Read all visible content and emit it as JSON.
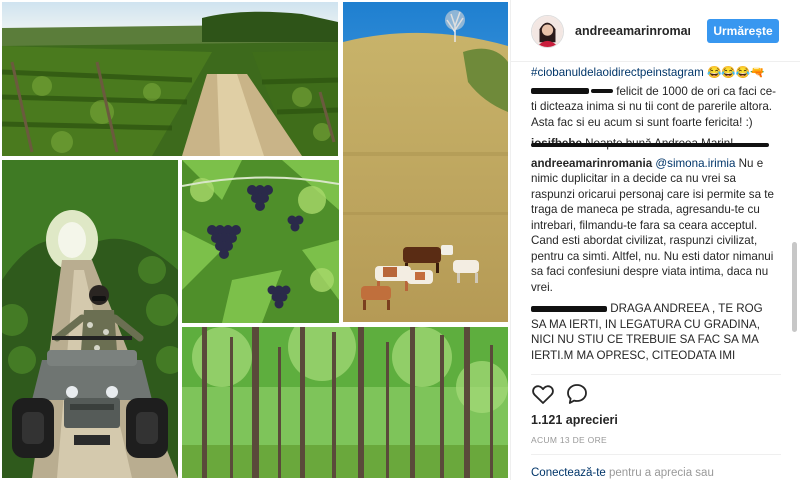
{
  "post": {
    "username": "andreeamarinromania",
    "follow_label": "Urmărește",
    "likes": "1.121 aprecieri",
    "timestamp": "ACUM 13 DE ORE",
    "login_link": "Conectează-te",
    "login_rest": " pentru a aprecia sau"
  },
  "comments": {
    "hashtag": "#ciobanuldelaoidirectpeinstagram",
    "hashtag_emoji": "😂😂😂🔫",
    "first_text": " felicit de 1000 de ori ca faci ce-ti dicteaza inima si nu tii cont de parerile altora. Asta fac si eu acum si sunt foarte fericita! :)",
    "second_user": "iosifbebe",
    "second_text": " Noapte bună Andreea Marin!",
    "reply_user": "andreeamarinromania",
    "reply_mention": "@simona.irimia",
    "reply_text": " Nu e nimic duplicitar in a decide ca nu vrei sa raspunzi oricarui personaj care isi permite sa te traga de maneca pe strada, agresandu-te cu intrebari, filmandu-te fara sa ceara acceptul. Cand esti abordat civilizat, raspunzi civilizat, pentru ca simti. Altfel, nu. Nu esti dator nimanui sa faci confesiuni despre viata intima, daca nu vrei.",
    "last_text": " DRAGA ANDREEA , TE ROG SA MA IERTI, IN LEGATURA CU GRADINA, NICI NU STIU CE TREBUIE SA FAC SA MA IERTI.M MA OPRESC, CITEODATA IMI"
  },
  "colors": {
    "accent": "#3897f0",
    "link": "#003569",
    "muted": "#999999"
  },
  "icons": {
    "like": "heart-outline-icon",
    "comment": "speech-bubble-icon"
  }
}
